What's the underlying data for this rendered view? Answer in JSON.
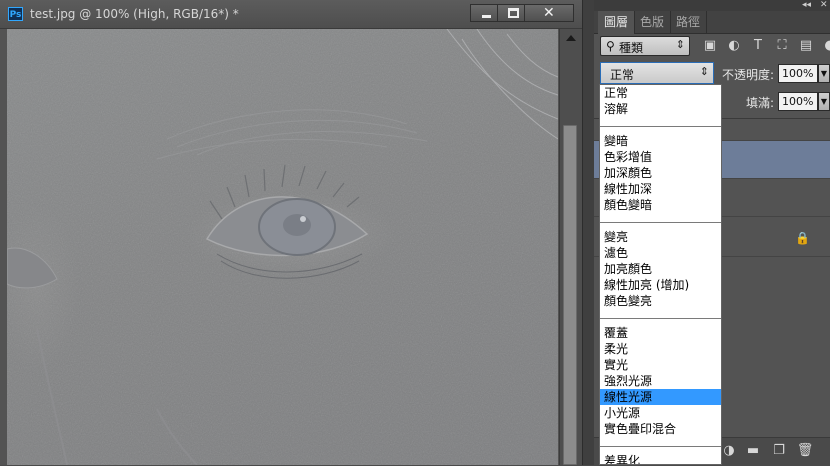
{
  "document": {
    "title": "test.jpg @ 100% (High, RGB/16*) *",
    "app_icon": "Ps",
    "window_buttons": {
      "minimize": "minimize-icon",
      "maximize": "maximize-icon",
      "close": "✕"
    }
  },
  "panel": {
    "tabs": [
      "圖層",
      "色版",
      "路徑"
    ],
    "active_tab": 0,
    "filter": {
      "kind_label": "種類",
      "icons": [
        "image-filter-icon",
        "adjustment-filter-icon",
        "type-filter-icon",
        "shape-filter-icon",
        "smart-object-filter-icon"
      ]
    },
    "blend_mode": {
      "selected": "正常"
    },
    "opacity": {
      "label": "不透明度:",
      "value": "100%"
    },
    "fill": {
      "label": "填滿:",
      "value": "100%"
    },
    "bottom_icons": [
      "adjustment-layer-icon",
      "group-folder-icon",
      "new-layer-icon",
      "trash-icon"
    ]
  },
  "blend_menu": {
    "groups": [
      [
        "正常",
        "溶解"
      ],
      [
        "變暗",
        "色彩增值",
        "加深顏色",
        "線性加深",
        "顏色變暗"
      ],
      [
        "變亮",
        "濾色",
        "加亮顏色",
        "線性加亮 (增加)",
        "顏色變亮"
      ],
      [
        "覆蓋",
        "柔光",
        "實光",
        "強烈光源",
        "線性光源",
        "小光源",
        "實色疊印混合"
      ],
      [
        "差異化"
      ]
    ],
    "highlighted": "線性光源",
    "highlight_color": "#3399ff"
  },
  "colors": {
    "ps_blue": "#31a8ff",
    "selected_layer": "#6d7d99"
  }
}
